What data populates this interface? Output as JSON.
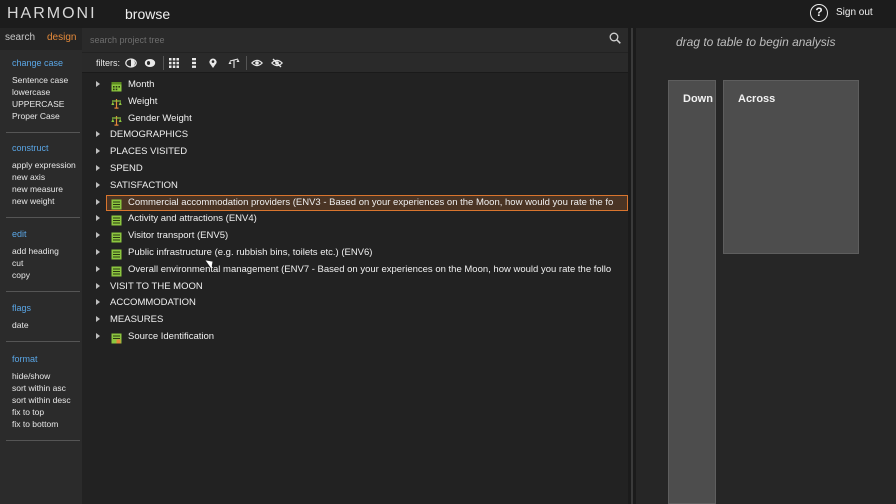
{
  "header": {
    "logo": "HARMONI",
    "section": "browse",
    "help_symbol": "?",
    "signout_label": "Sign out"
  },
  "sidebar": {
    "tabs": {
      "search": "search",
      "design": "design"
    },
    "groups": [
      {
        "title": "change case",
        "items": [
          "Sentence case",
          "lowercase",
          "UPPERCASE",
          "Proper Case"
        ]
      },
      {
        "title": "construct",
        "items": [
          "apply expression",
          "new axis",
          "new measure",
          "new weight"
        ]
      },
      {
        "title": "edit",
        "items": [
          "add heading",
          "cut",
          "copy"
        ]
      },
      {
        "title": "flags",
        "items": [
          "date"
        ]
      },
      {
        "title": "format",
        "items": [
          "hide/show",
          "sort within asc",
          "sort within desc",
          "fix to top",
          "fix to bottom"
        ]
      }
    ]
  },
  "tree": {
    "search_placeholder": "search project tree",
    "filters_label": "filters:",
    "rows": [
      {
        "label": "Month",
        "icon": "calendar-variable-icon",
        "expandable": true
      },
      {
        "label": "Weight",
        "icon": "scale-variable-icon",
        "expandable": false
      },
      {
        "label": "Gender Weight",
        "icon": "scale-variable-icon",
        "expandable": false
      },
      {
        "label": "DEMOGRAPHICS",
        "icon": "",
        "expandable": true
      },
      {
        "label": "PLACES VISITED",
        "icon": "",
        "expandable": true
      },
      {
        "label": "SPEND",
        "icon": "",
        "expandable": true
      },
      {
        "label": "SATISFACTION",
        "icon": "",
        "expandable": true
      },
      {
        "label": "Commercial accommodation providers (ENV3 - Based on your experiences on the Moon, how would you rate the fo",
        "icon": "list-variable-icon",
        "expandable": true,
        "selected": true
      },
      {
        "label": "Activity and attractions (ENV4)",
        "icon": "list-variable-icon",
        "expandable": true
      },
      {
        "label": "Visitor transport (ENV5)",
        "icon": "list-variable-icon",
        "expandable": true
      },
      {
        "label": "Public infrastructure (e.g. rubbish bins, toilets etc.) (ENV6)",
        "icon": "list-variable-icon",
        "expandable": true
      },
      {
        "label": "Overall environmental management (ENV7 - Based on your experiences on the Moon, how would you rate the follo",
        "icon": "list-variable-icon",
        "expandable": true
      },
      {
        "label": "VISIT TO THE MOON",
        "icon": "",
        "expandable": true
      },
      {
        "label": "ACCOMMODATION",
        "icon": "",
        "expandable": true
      },
      {
        "label": "MEASURES",
        "icon": "",
        "expandable": true
      },
      {
        "label": "Source Identification",
        "icon": "source-variable-icon",
        "expandable": true
      }
    ]
  },
  "analysis": {
    "hint": "drag to table to begin analysis",
    "down_label": "Down",
    "across_label": "Across"
  },
  "colors": {
    "accent_orange": "#e3893a",
    "link_blue": "#5aa6e6",
    "variable_green": "#8cc63f"
  }
}
